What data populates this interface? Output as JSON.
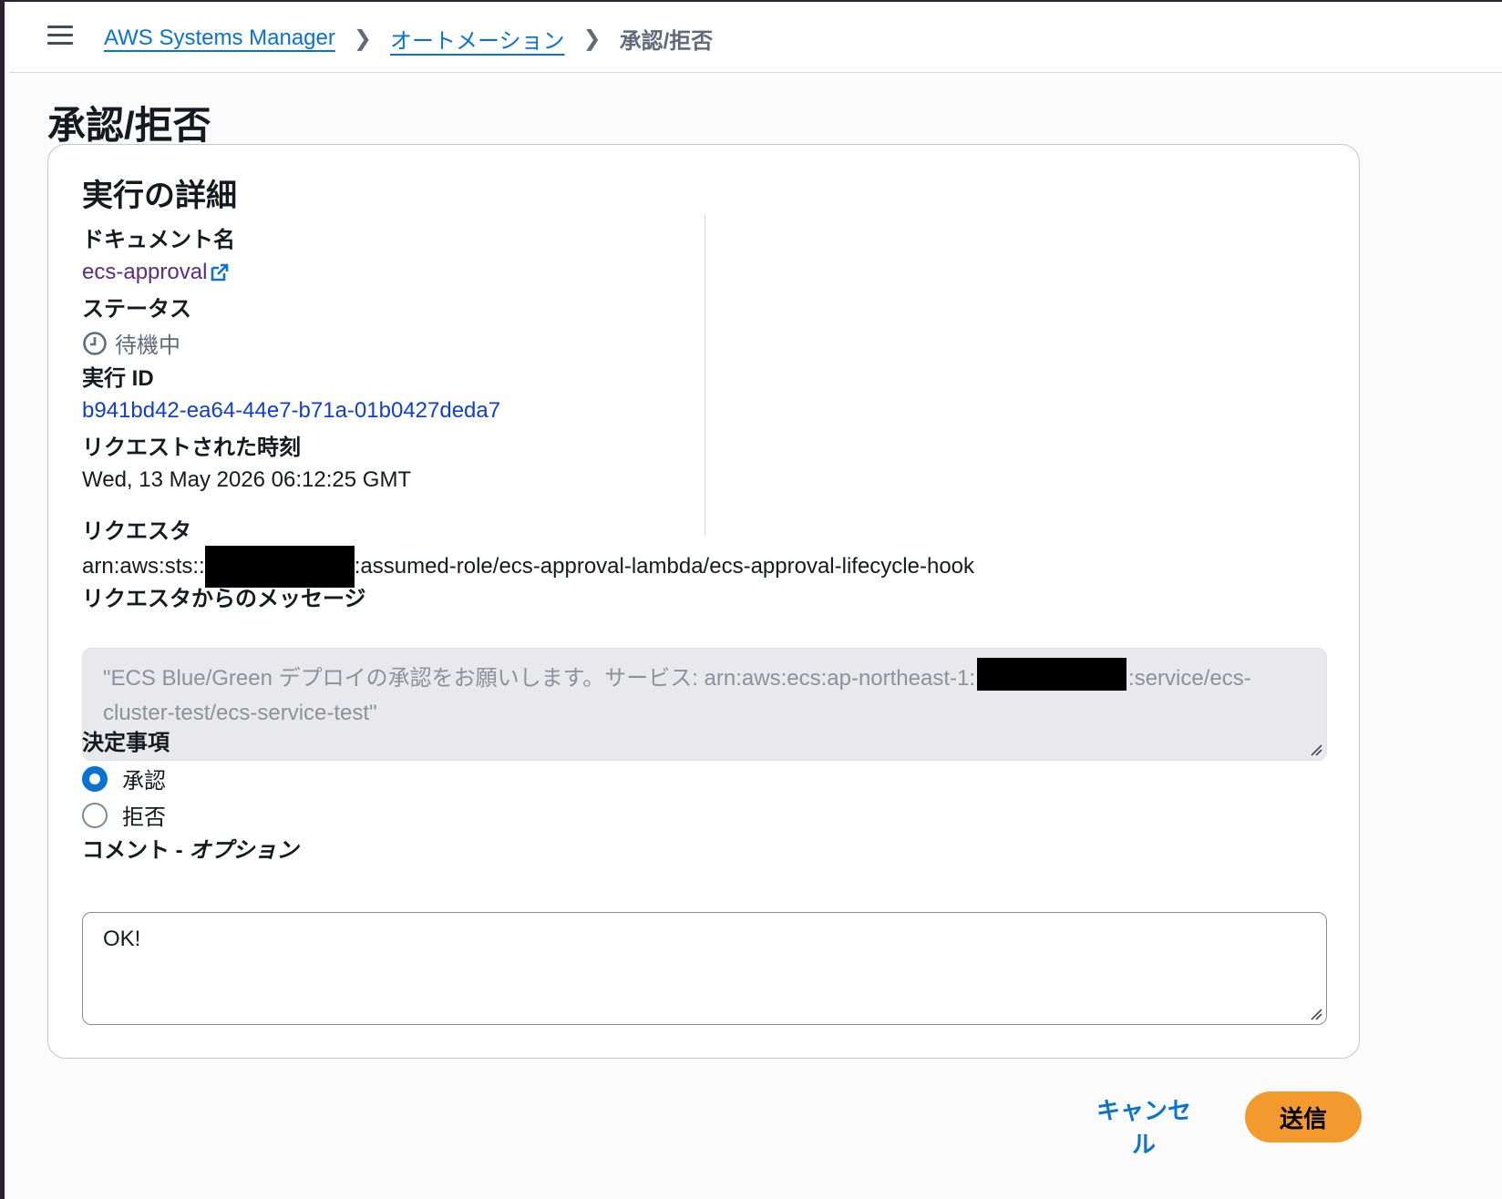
{
  "header": {
    "menu_icon": "hamburger-menu-icon",
    "breadcrumbs": [
      {
        "label": "AWS Systems Manager",
        "link": true
      },
      {
        "label": "オートメーション",
        "link": true
      },
      {
        "label": "承認/拒否",
        "link": false
      }
    ]
  },
  "page": {
    "title": "承認/拒否"
  },
  "details": {
    "title": "実行の詳細",
    "document_name_label": "ドキュメント名",
    "document_name": "ecs-approval",
    "document_link_icon": "external-link-icon",
    "status_label": "ステータス",
    "status_icon": "clock-icon",
    "status_value": "待機中",
    "execution_id_label": "実行 ID",
    "execution_id": "b941bd42-ea64-44e7-b71a-01b0427deda7",
    "requested_time_label": "リクエストされた時刻",
    "requested_time": "Wed, 13 May 2026 06:12:25 GMT",
    "requester_label": "リクエスタ",
    "requester_prefix": "arn:aws:sts::",
    "requester_suffix": ":assumed-role/ecs-approval-lambda/ecs-approval-lifecycle-hook",
    "message_label": "リクエスタからのメッセージ",
    "message_part1": "\"ECS Blue/Green デプロイの承認をお願いします。サービス: arn:aws:ecs:ap-northeast-1:",
    "message_part2": ":service/ecs-cluster-test/ecs-service-test\""
  },
  "decision": {
    "label": "決定事項",
    "options": [
      {
        "label": "承認",
        "checked": true
      },
      {
        "label": "拒否",
        "checked": false
      }
    ]
  },
  "comment": {
    "label_main": "コメント - ",
    "label_optional": "オプション",
    "value": "OK!"
  },
  "actions": {
    "cancel_label": "キャンセル",
    "submit_label": "送信"
  },
  "colors": {
    "link": "#0972d3",
    "visited_link": "#5b2b8a",
    "primary_button": "#f29a2e"
  }
}
